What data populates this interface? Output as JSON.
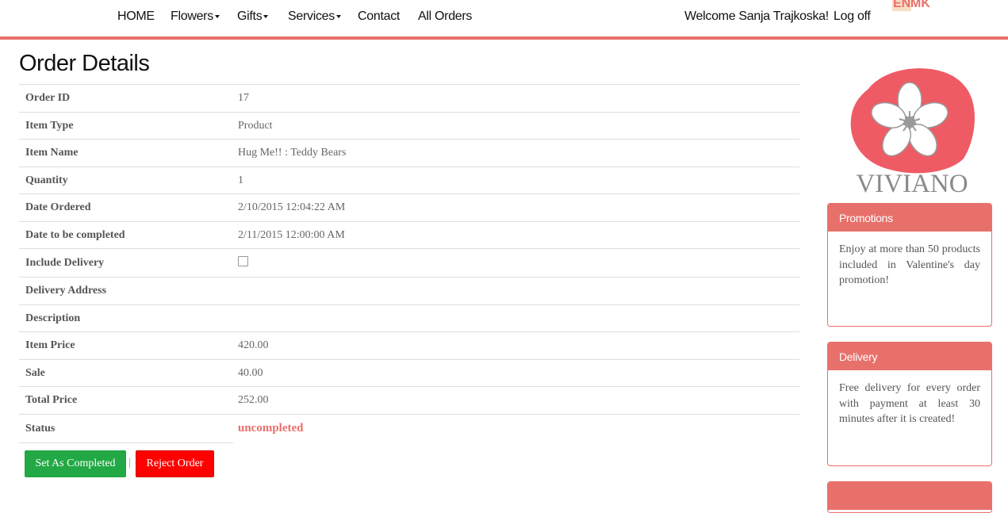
{
  "nav": {
    "home": "HOME",
    "flowers": "Flowers",
    "gifts": "Gifts",
    "services": "Services",
    "contact": "Contact",
    "all_orders": "All Orders",
    "welcome": "Welcome Sanja Trajkoska!",
    "logoff": "Log off",
    "lang_en": "EN",
    "lang_mk": "MK"
  },
  "page": {
    "title": "Order Details"
  },
  "order": {
    "rows": [
      {
        "label": "Order ID",
        "value": "17"
      },
      {
        "label": "Item Type",
        "value": "Product"
      },
      {
        "label": "Item Name",
        "value": "Hug Me!! : Teddy Bears"
      },
      {
        "label": "Quantity",
        "value": "1"
      },
      {
        "label": "Date Ordered",
        "value": "2/10/2015 12:04:22 AM"
      },
      {
        "label": "Date to be completed",
        "value": "2/11/2015 12:00:00 AM"
      },
      {
        "label": "Include Delivery",
        "value": ""
      },
      {
        "label": "Delivery Address",
        "value": ""
      },
      {
        "label": "Description",
        "value": ""
      },
      {
        "label": "Item Price",
        "value": "420.00"
      },
      {
        "label": "Sale",
        "value": "40.00"
      },
      {
        "label": "Total Price",
        "value": "252.00"
      },
      {
        "label": "Status",
        "value": "uncompleted"
      }
    ],
    "include_delivery_checked": false
  },
  "actions": {
    "complete_label": "Set As Completed",
    "separator": "|",
    "reject_label": "Reject Order"
  },
  "sidebar": {
    "logo_text": "VIVIANO",
    "promotions": {
      "title": "Promotions",
      "body": "Enjoy at more than 50 products included in Valentine's day promotion!"
    },
    "delivery": {
      "title": "Delivery",
      "body": "Free delivery for every order with payment at least 30 minutes after it is created!"
    }
  },
  "colors": {
    "accent": "#e8706b",
    "success": "#22a844",
    "danger": "#ff0000"
  }
}
